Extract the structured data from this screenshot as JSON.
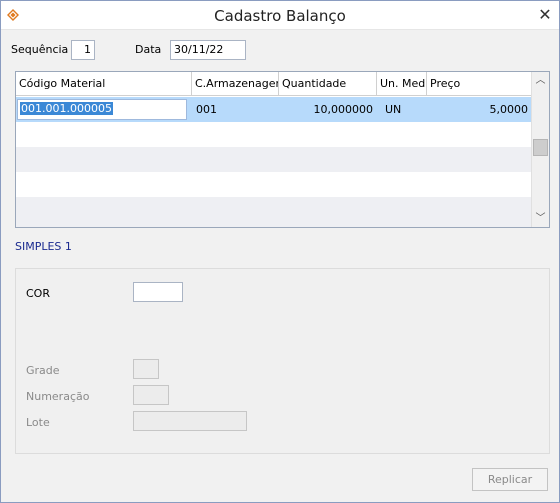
{
  "window": {
    "title": "Cadastro Balanço",
    "close_glyph": "✕",
    "icon": "app-logo-icon"
  },
  "header": {
    "sequencia_label": "Sequência",
    "sequencia_value": "1",
    "data_label": "Data",
    "data_value": "30/11/22"
  },
  "grid": {
    "columns": [
      "Código Material",
      "C.Armazenagem",
      "Quantidade",
      "Un. Med.",
      "Preço"
    ],
    "rows": [
      {
        "codigo": "001.001.000005",
        "armazenagem": "001",
        "quantidade": "10,000000",
        "unidade": "UN",
        "preco": "5,0000"
      }
    ]
  },
  "section_title": "SIMPLES 1",
  "fields": {
    "cor_label": "COR",
    "cor_value": "",
    "grade_label": "Grade",
    "grade_value": "",
    "numeracao_label": "Numeração",
    "numeracao_value": "",
    "lote_label": "Lote",
    "lote_value": ""
  },
  "actions": {
    "replicar_label": "Replicar"
  }
}
